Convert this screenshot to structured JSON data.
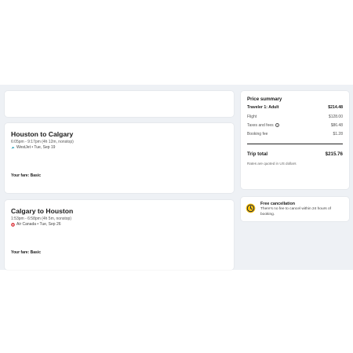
{
  "flights": [
    {
      "title": "Houston to Calgary",
      "times": "6:05pm - 9:17pm (4h 12m, nonstop)",
      "airline": "WestJet • Tue, Sep 19",
      "fare": "Your fare: Basic"
    },
    {
      "title": "Calgary to Houston",
      "times": "1:53pm - 6:58pm (4h 5m, nonstop)",
      "airline": "Air Canada • Tue, Sep 26",
      "fare": "Your fare: Basic"
    }
  ],
  "summary": {
    "title": "Price summary",
    "traveler_label": "Traveler 1: Adult",
    "traveler_value": "$214.48",
    "flight_label": "Flight",
    "flight_value": "$128.00",
    "taxes_label": "Taxes and fees",
    "taxes_value": "$86.48",
    "booking_label": "Booking fee",
    "booking_value": "$1.28",
    "total_label": "Trip total",
    "total_value": "$215.76",
    "note": "Rates are quoted in US dollars"
  },
  "cancellation": {
    "title": "Free cancellation",
    "text": "There's no fee to cancel within 24 hours of booking."
  },
  "colors": {
    "accent_yellow": "#ffc107",
    "westjet": "#1a9bb5",
    "aircanada": "#d62027"
  }
}
